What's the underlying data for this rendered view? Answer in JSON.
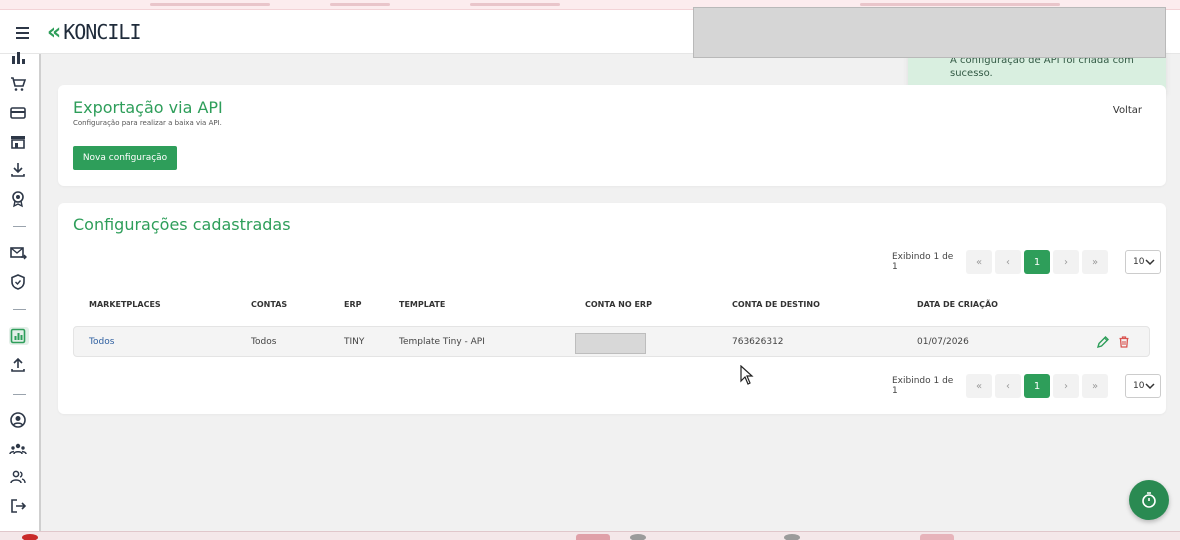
{
  "header": {
    "logo_text": "KONCILI",
    "logo_mark": "«"
  },
  "toast": {
    "message": "A configuração de API foi criada com sucesso."
  },
  "sidebar": {
    "items": [
      {
        "icon": "bar-chart-icon",
        "active": false
      },
      {
        "icon": "cart-icon",
        "active": false
      },
      {
        "icon": "credit-card-icon",
        "active": false
      },
      {
        "icon": "store-icon",
        "active": false
      },
      {
        "icon": "download-icon",
        "active": false
      },
      {
        "icon": "award-icon",
        "active": false
      },
      {
        "icon": "mail-forward-icon",
        "active": false
      },
      {
        "icon": "shield-icon",
        "active": false
      },
      {
        "icon": "report-icon",
        "active": true
      },
      {
        "icon": "upload-icon",
        "active": false
      },
      {
        "icon": "user-circle-icon",
        "active": false
      },
      {
        "icon": "team-icon",
        "active": false
      },
      {
        "icon": "users-icon",
        "active": false
      },
      {
        "icon": "logout-icon",
        "active": false
      }
    ]
  },
  "export_card": {
    "title": "Exportação via API",
    "subtitle": "Configuração para realizar a baixa via API.",
    "back_label": "Voltar",
    "new_button_label": "Nova configuração"
  },
  "configs_card": {
    "title": "Configurações cadastradas",
    "pagination": {
      "info": "Exibindo 1 de 1",
      "first": "«",
      "prev": "‹",
      "current_page": "1",
      "next": "›",
      "last": "»",
      "page_size": "10"
    },
    "columns": [
      "MARKETPLACES",
      "CONTAS",
      "ERP",
      "TEMPLATE",
      "CONTA NO ERP",
      "CONTA DE DESTINO",
      "DATA DE CRIAÇÃO"
    ],
    "rows": [
      {
        "marketplaces": "Todos",
        "contas": "Todos",
        "erp": "TINY",
        "template": "Template Tiny - API",
        "conta_erp": "",
        "conta_destino": "763626312",
        "data_criacao": "01/07/2026"
      }
    ]
  },
  "colors": {
    "accent": "#2e9e5a",
    "toast_bg": "#d9efe0",
    "link": "#2e5fa0",
    "delete": "#d9534f"
  }
}
